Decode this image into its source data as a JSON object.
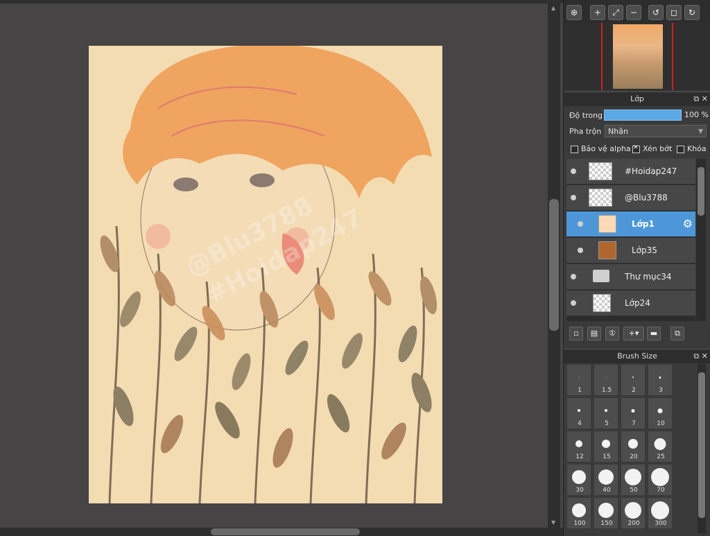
{
  "navigator": {
    "toolbar_icons": [
      "zoom-actual-icon",
      "zoom-in-icon",
      "fit-screen-icon",
      "zoom-out-icon",
      "rotate-left-icon",
      "reset-view-icon",
      "rotate-right-icon"
    ]
  },
  "layer_panel": {
    "title": "Lớp",
    "opacity_label": "Độ trong",
    "opacity_value": "100 %",
    "opacity_fraction": 1.0,
    "blend_label": "Pha trộn",
    "blend_value": "Nhân",
    "protect_alpha_label": "Bảo vệ alpha",
    "protect_alpha_checked": false,
    "clipping_label": "Xén bớt",
    "clipping_checked": true,
    "lock_label": "Khóa",
    "lock_checked": false,
    "layers": [
      {
        "name": "#Hoidap247",
        "selected": false
      },
      {
        "name": "@Blu3788",
        "selected": false
      },
      {
        "name": "Lớp1",
        "selected": true
      },
      {
        "name": "Lớp35",
        "selected": false
      },
      {
        "name": "Thư mục34",
        "selected": false
      },
      {
        "name": "Lớp24",
        "selected": false
      }
    ]
  },
  "brush_panel": {
    "title": "Brush Size",
    "sizes": [
      "1",
      "1.5",
      "2",
      "3",
      "4",
      "5",
      "7",
      "10",
      "12",
      "15",
      "20",
      "25",
      "30",
      "40",
      "50",
      "70",
      "100",
      "150",
      "200",
      "300"
    ]
  },
  "colors": {
    "accent": "#4d97d9",
    "canvas_bg": "#f3dcb2",
    "workspace": "#464444"
  },
  "canvas": {
    "watermark_1": "@Blu3788",
    "watermark_2": "#Hoidap247"
  }
}
